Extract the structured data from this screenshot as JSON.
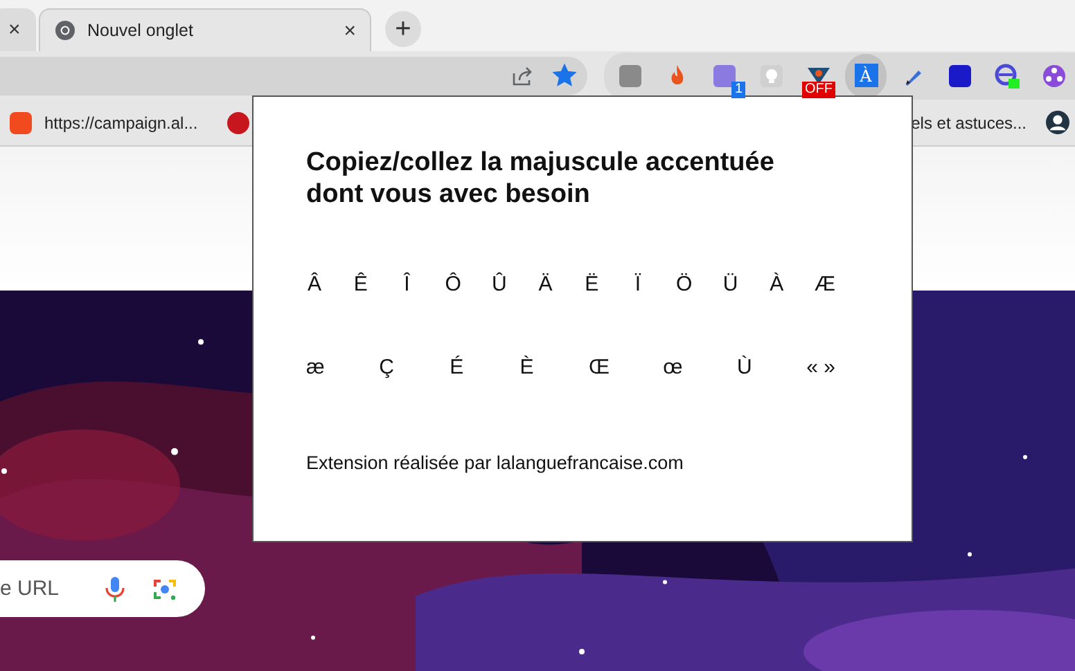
{
  "tabs": [
    {
      "close": "×",
      "selected": false
    },
    {
      "title": "Nouvel onglet",
      "close": "×",
      "selected": true
    }
  ],
  "new_tab": "+",
  "toolbar": {
    "bookmarked": true
  },
  "extensions": [
    {
      "kind": "tile",
      "selected": false
    },
    {
      "kind": "flame",
      "selected": false
    },
    {
      "kind": "tile2",
      "badge": "1",
      "selected": false
    },
    {
      "kind": "bulb",
      "selected": false
    },
    {
      "kind": "shield",
      "badge": "OFF",
      "selected": false
    },
    {
      "kind": "letter",
      "label": "À",
      "selected": true
    },
    {
      "kind": "pen",
      "selected": false
    },
    {
      "kind": "tile3",
      "selected": false
    },
    {
      "kind": "ring",
      "selected": false
    },
    {
      "kind": "dots",
      "selected": false
    }
  ],
  "bookmarks": [
    {
      "label": "https://campaign.al..."
    },
    {
      "label": "els et astuces..."
    }
  ],
  "popup": {
    "title": "Copiez/collez la majuscule accentuée dont vous avec besoin",
    "row_1": [
      "Â",
      "Ê",
      "Î",
      "Ô",
      "Û",
      "Ä",
      "Ë",
      "Ï",
      "Ö",
      "Ü",
      "À",
      "Æ"
    ],
    "row_2": [
      "æ",
      "Ç",
      "É",
      "È",
      "Œ",
      "œ",
      "Ù",
      "« »"
    ],
    "footer": "Extension réalisée par lalanguefrancaise.com"
  },
  "search": {
    "placeholder": "e URL"
  }
}
